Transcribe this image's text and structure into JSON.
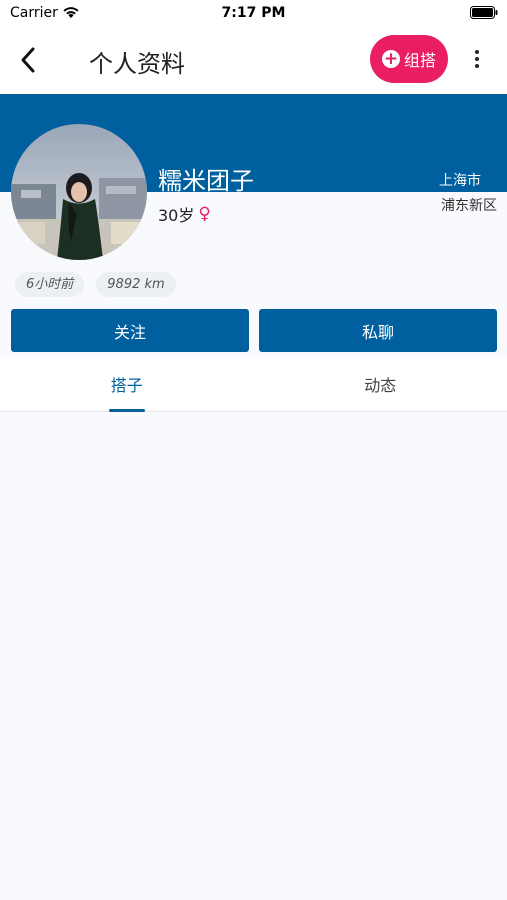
{
  "status_bar": {
    "carrier": "Carrier",
    "time": "7:17 PM"
  },
  "nav": {
    "title": "个人资料",
    "create_label": "组搭",
    "accent_color": "#e91e63"
  },
  "profile": {
    "nickname": "糯米团子",
    "age": "30岁",
    "gender_icon": "female-icon",
    "city": "上海市",
    "district": "浦东新区",
    "last_active": "6小时前",
    "distance": "9892 km",
    "brand_color": "#00609f"
  },
  "actions": {
    "follow": "关注",
    "message": "私聊"
  },
  "tabs": [
    {
      "label": "搭子",
      "active": true
    },
    {
      "label": "动态",
      "active": false
    }
  ]
}
